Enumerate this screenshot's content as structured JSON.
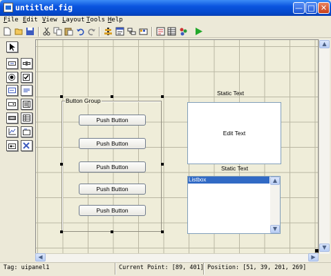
{
  "window": {
    "title": "untitled.fig",
    "controls": [
      "minimize",
      "maximize",
      "close"
    ]
  },
  "menu": {
    "items": [
      "File",
      "Edit",
      "View",
      "Layout",
      "Tools",
      "Help"
    ]
  },
  "toolbar": {
    "icons": [
      "new-file-icon",
      "open-folder-icon",
      "save-icon",
      "cut-icon",
      "copy-icon",
      "paste-icon",
      "undo-icon",
      "redo-icon",
      "align-objects-icon",
      "menu-editor-icon",
      "tab-order-icon",
      "toolbar-editor-icon",
      "m-file-editor-icon",
      "property-inspector-icon",
      "object-browser-icon",
      "run-figure-icon"
    ]
  },
  "palette": {
    "tools": [
      "select-pointer-icon",
      "push-button-tool-icon",
      "slider-tool-icon",
      "radio-button-tool-icon",
      "checkbox-tool-icon",
      "edit-text-tool-icon",
      "static-text-tool-icon",
      "popup-menu-tool-icon",
      "listbox-tool-icon",
      "toggle-button-tool-icon",
      "table-tool-icon",
      "axes-tool-icon",
      "panel-tool-icon",
      "button-group-tool-icon",
      "activex-control-tool-icon"
    ]
  },
  "canvas": {
    "button_group": {
      "title": "Button Group",
      "buttons": [
        "Push Button",
        "Push Button",
        "Push Button",
        "Push Button",
        "Push Button"
      ]
    },
    "static_text_1": "Static Text",
    "edit_text": "Edit Text",
    "static_text_2": "Static Text",
    "listbox": {
      "items": [
        "Listbox"
      ]
    }
  },
  "status": {
    "tag": "Tag: uipanel1",
    "current_point": "Current Point:  [89, 401]",
    "position": "Position: [51, 39, 201, 269]"
  }
}
